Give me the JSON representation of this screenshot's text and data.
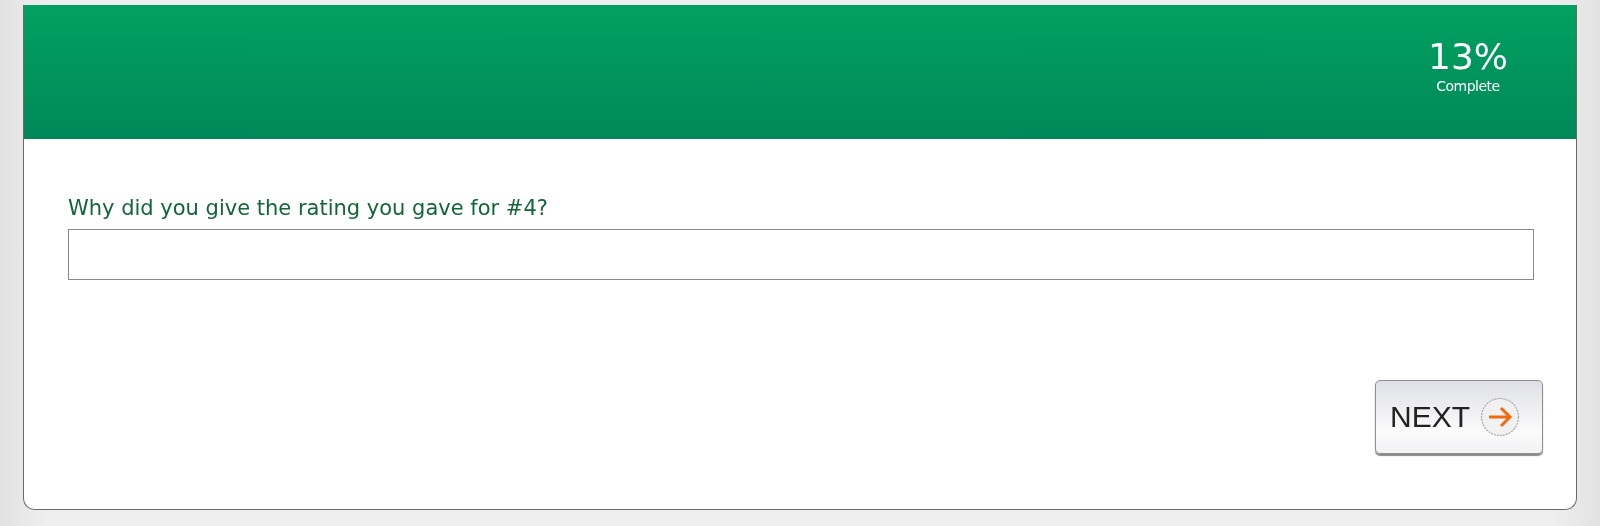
{
  "header": {
    "percent": "13%",
    "caption": "Complete"
  },
  "question": {
    "label": "Why did you give the rating you gave for #4?"
  },
  "next_button": {
    "label": "NEXT"
  }
}
